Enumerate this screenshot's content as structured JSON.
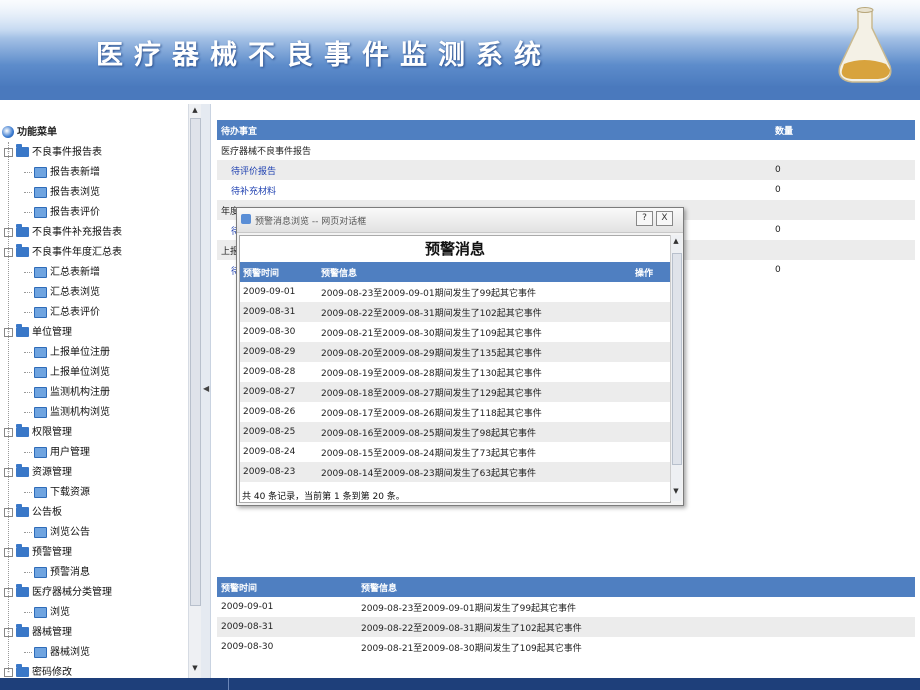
{
  "header": {
    "title": "医疗器械不良事件监测系统"
  },
  "sidebar": {
    "root": "功能菜单",
    "items": [
      {
        "label": "不良事件报告表",
        "type": "folder",
        "level": 0
      },
      {
        "label": "报告表新增",
        "type": "page",
        "level": 1
      },
      {
        "label": "报告表浏览",
        "type": "page",
        "level": 1
      },
      {
        "label": "报告表评价",
        "type": "page",
        "level": 1
      },
      {
        "label": "不良事件补充报告表",
        "type": "folder",
        "level": 0
      },
      {
        "label": "不良事件年度汇总表",
        "type": "folder",
        "level": 0
      },
      {
        "label": "汇总表新增",
        "type": "page",
        "level": 1
      },
      {
        "label": "汇总表浏览",
        "type": "page",
        "level": 1
      },
      {
        "label": "汇总表评价",
        "type": "page",
        "level": 1
      },
      {
        "label": "单位管理",
        "type": "folder",
        "level": 0
      },
      {
        "label": "上报单位注册",
        "type": "page",
        "level": 1
      },
      {
        "label": "上报单位浏览",
        "type": "page",
        "level": 1
      },
      {
        "label": "监测机构注册",
        "type": "page",
        "level": 1
      },
      {
        "label": "监测机构浏览",
        "type": "page",
        "level": 1
      },
      {
        "label": "权限管理",
        "type": "folder",
        "level": 0
      },
      {
        "label": "用户管理",
        "type": "page",
        "level": 1
      },
      {
        "label": "资源管理",
        "type": "folder",
        "level": 0
      },
      {
        "label": "下载资源",
        "type": "page",
        "level": 1
      },
      {
        "label": "公告板",
        "type": "folder",
        "level": 0
      },
      {
        "label": "浏览公告",
        "type": "page",
        "level": 1
      },
      {
        "label": "预警管理",
        "type": "folder",
        "level": 0
      },
      {
        "label": "预警消息",
        "type": "page",
        "level": 1
      },
      {
        "label": "医疗器械分类管理",
        "type": "folder",
        "level": 0
      },
      {
        "label": "浏览",
        "type": "page",
        "level": 1
      },
      {
        "label": "器械管理",
        "type": "folder",
        "level": 0
      },
      {
        "label": "器械浏览",
        "type": "page",
        "level": 1
      },
      {
        "label": "密码修改",
        "type": "folder",
        "level": 0
      }
    ]
  },
  "todo": {
    "headers": [
      "待办事宜",
      "数量"
    ],
    "rows": [
      {
        "label": "医疗器械不良事件报告",
        "count": "",
        "link": false
      },
      {
        "label": "待评价报告",
        "count": "0",
        "link": true
      },
      {
        "label": "待补充材料",
        "count": "0",
        "link": true
      },
      {
        "label": "年度",
        "count": "",
        "link": false
      },
      {
        "label": "待",
        "count": "0",
        "link": true
      },
      {
        "label": "上报",
        "count": "",
        "link": false
      },
      {
        "label": "待",
        "count": "0",
        "link": true
      }
    ]
  },
  "dialog": {
    "title": "预警消息浏览 -- 网页对话框",
    "help_label": "?",
    "close_label": "X",
    "heading": "预警消息",
    "headers": [
      "预警时间",
      "预警信息",
      "操作"
    ],
    "rows": [
      [
        "2009-09-01",
        "2009-08-23至2009-09-01期间发生了99起其它事件"
      ],
      [
        "2009-08-31",
        "2009-08-22至2009-08-31期间发生了102起其它事件"
      ],
      [
        "2009-08-30",
        "2009-08-21至2009-08-30期间发生了109起其它事件"
      ],
      [
        "2009-08-29",
        "2009-08-20至2009-08-29期间发生了135起其它事件"
      ],
      [
        "2009-08-28",
        "2009-08-19至2009-08-28期间发生了130起其它事件"
      ],
      [
        "2009-08-27",
        "2009-08-18至2009-08-27期间发生了129起其它事件"
      ],
      [
        "2009-08-26",
        "2009-08-17至2009-08-26期间发生了118起其它事件"
      ],
      [
        "2009-08-25",
        "2009-08-16至2009-08-25期间发生了98起其它事件"
      ],
      [
        "2009-08-24",
        "2009-08-15至2009-08-24期间发生了73起其它事件"
      ],
      [
        "2009-08-23",
        "2009-08-14至2009-08-23期间发生了63起其它事件"
      ]
    ],
    "footer": "共 40 条记录，当前第 1 条到第 20 条。"
  },
  "alerts": {
    "headers": [
      "预警时间",
      "预警信息"
    ],
    "rows": [
      [
        "2009-09-01",
        "2009-08-23至2009-09-01期间发生了99起其它事件"
      ],
      [
        "2009-08-31",
        "2009-08-22至2009-08-31期间发生了102起其它事件"
      ],
      [
        "2009-08-30",
        "2009-08-21至2009-08-30期间发生了109起其它事件"
      ]
    ]
  },
  "colors": {
    "header_blue": "#3f6fb6",
    "table_head": "#4f7fc1",
    "link": "#1d3fb0",
    "status_bar": "#1e3f7a"
  }
}
